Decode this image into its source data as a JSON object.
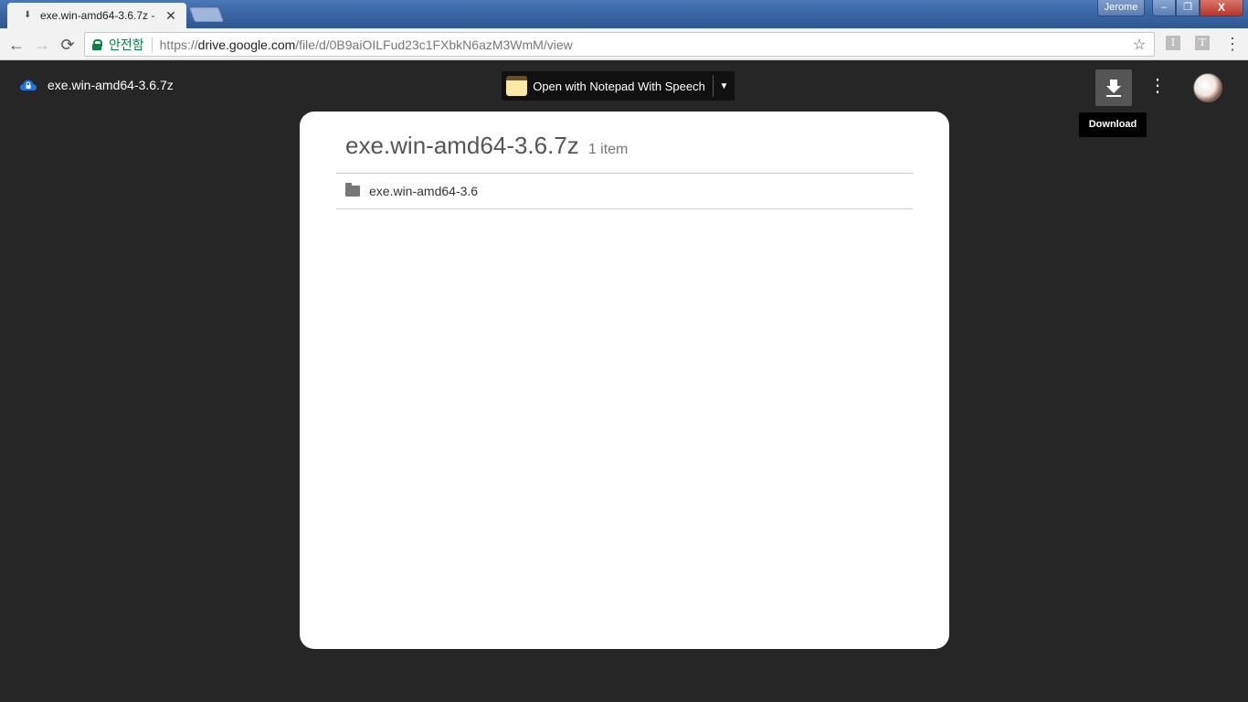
{
  "browser": {
    "tab": {
      "title": "exe.win-amd64-3.6.7z -",
      "favicon": "download-icon"
    },
    "profile_name": "Jerome",
    "window_controls": {
      "minimize": "–",
      "maximize": "❐",
      "close": "X"
    },
    "nav": {
      "back": "←",
      "forward": "→",
      "reload": "⟳"
    },
    "omnibox": {
      "secure_label": "안전함",
      "url_scheme": "https://",
      "url_domain": "drive.google.com",
      "url_path": "/file/d/0B9aiOILFud23c1FXbkN6azM3WmM/view"
    },
    "extensions": [
      {
        "label": "I"
      },
      {
        "label": "T"
      }
    ],
    "menu_icon": "⋮",
    "star_icon": "☆"
  },
  "viewer": {
    "file_title": "exe.win-amd64-3.6.7z",
    "open_with_label": "Open with Notepad With Speech",
    "open_with_caret": "▼",
    "more_icon": "⋮",
    "tooltip": "Download"
  },
  "archive": {
    "name": "exe.win-amd64-3.6.7z",
    "item_count": "1 item",
    "entries": [
      {
        "type": "folder",
        "name": "exe.win-amd64-3.6"
      }
    ]
  },
  "colors": {
    "background": "#262626",
    "secure_green": "#0b8043",
    "card": "#ffffff"
  }
}
